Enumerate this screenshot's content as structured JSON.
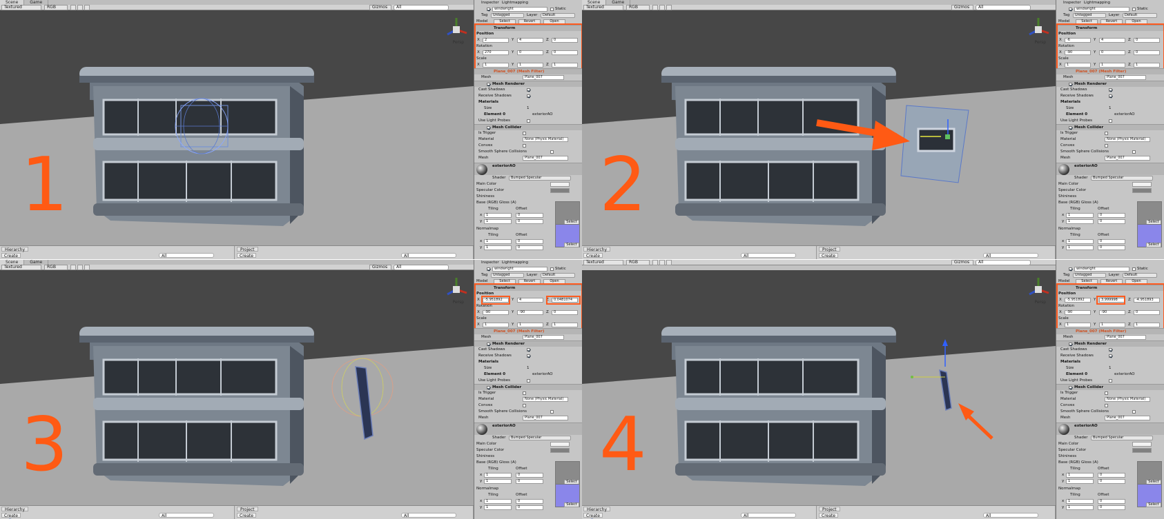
{
  "colors": {
    "accent": "#ff5a1e",
    "viewport_floor": "#a9a9a9",
    "sky": "#474747",
    "inspector_bg": "#c6c6c6"
  },
  "common": {
    "tab_scene": "Scene",
    "tab_game": "Game",
    "shading": "Textured",
    "rgb": "RGB",
    "gizmos": "Gizmos",
    "search_all": "All",
    "persp": "Persp",
    "hierarchy": "Hierarchy",
    "project": "Project",
    "create": "Create",
    "inspector": {
      "tab_inspector": "Inspector",
      "tab_lightmapping": "Lightmapping",
      "object_name": "windwright",
      "static_label": "Static",
      "tag_label": "Tag",
      "tag_value": "Untagged",
      "layer_label": "Layer",
      "layer_value": "Default",
      "model_label": "Model",
      "select_btn": "Select",
      "revert_btn": "Revert",
      "open_btn": "Open",
      "transform": "Transform",
      "position": "Position",
      "rotation": "Rotation",
      "scale": "Scale",
      "mesh_filter": "Plane_007 (Mesh Filter)",
      "mesh_label": "Mesh",
      "mesh_value": "Plane_007",
      "mesh_renderer": "Mesh Renderer",
      "cast_shadows": "Cast Shadows",
      "receive_shadows": "Receive Shadows",
      "materials": "Materials",
      "size": "Size",
      "size_value": "1",
      "element0": "Element 0",
      "element0_value": "exteriorAO",
      "use_light_probes": "Use Light Probes",
      "mesh_collider": "Mesh Collider",
      "is_trigger": "Is Trigger",
      "material": "Material",
      "material_value": "None (Physic Material)",
      "convex": "Convex",
      "smooth": "Smooth Sphere Collisions",
      "collider_mesh": "Mesh",
      "collider_mesh_value": "Plane_007",
      "mat_name": "exteriorAO",
      "shader_label": "Shader",
      "shader_value": "Bumped Specular",
      "main_color": "Main Color",
      "specular_color": "Specular Color",
      "shininess": "Shininess",
      "base_label": "Base (RGB) Gloss (A)",
      "tiling": "Tiling",
      "offset": "Offset",
      "x": "x",
      "y": "y",
      "one": "1",
      "zero": "0",
      "select_small": "Select",
      "normalmap": "Normalmap"
    }
  },
  "panels": [
    {
      "label": "1",
      "hier_item": "",
      "pos": [
        "2",
        "4",
        "0"
      ],
      "rot": [
        "270",
        "0",
        "0"
      ],
      "scl": [
        "1",
        "1",
        "1"
      ]
    },
    {
      "label": "2",
      "hier_item": "",
      "pos": [
        "-6",
        "4",
        "0"
      ],
      "rot": [
        "-90",
        "0",
        "0"
      ],
      "scl": [
        "1",
        "1",
        "1"
      ]
    },
    {
      "label": "3",
      "hier_item": "wall_corner",
      "pos": [
        "-5.951892",
        "4",
        "0.0481074"
      ],
      "rot": [
        "-90",
        "-90",
        "0"
      ],
      "scl": [
        "1",
        "1",
        "1"
      ]
    },
    {
      "label": "4",
      "hier_item": "wall_corner",
      "pos": [
        "-5.951892",
        "3.999998",
        "-4.951893"
      ],
      "rot": [
        "-90",
        "-90",
        "0"
      ],
      "scl": [
        "1",
        "1",
        "1"
      ]
    }
  ]
}
